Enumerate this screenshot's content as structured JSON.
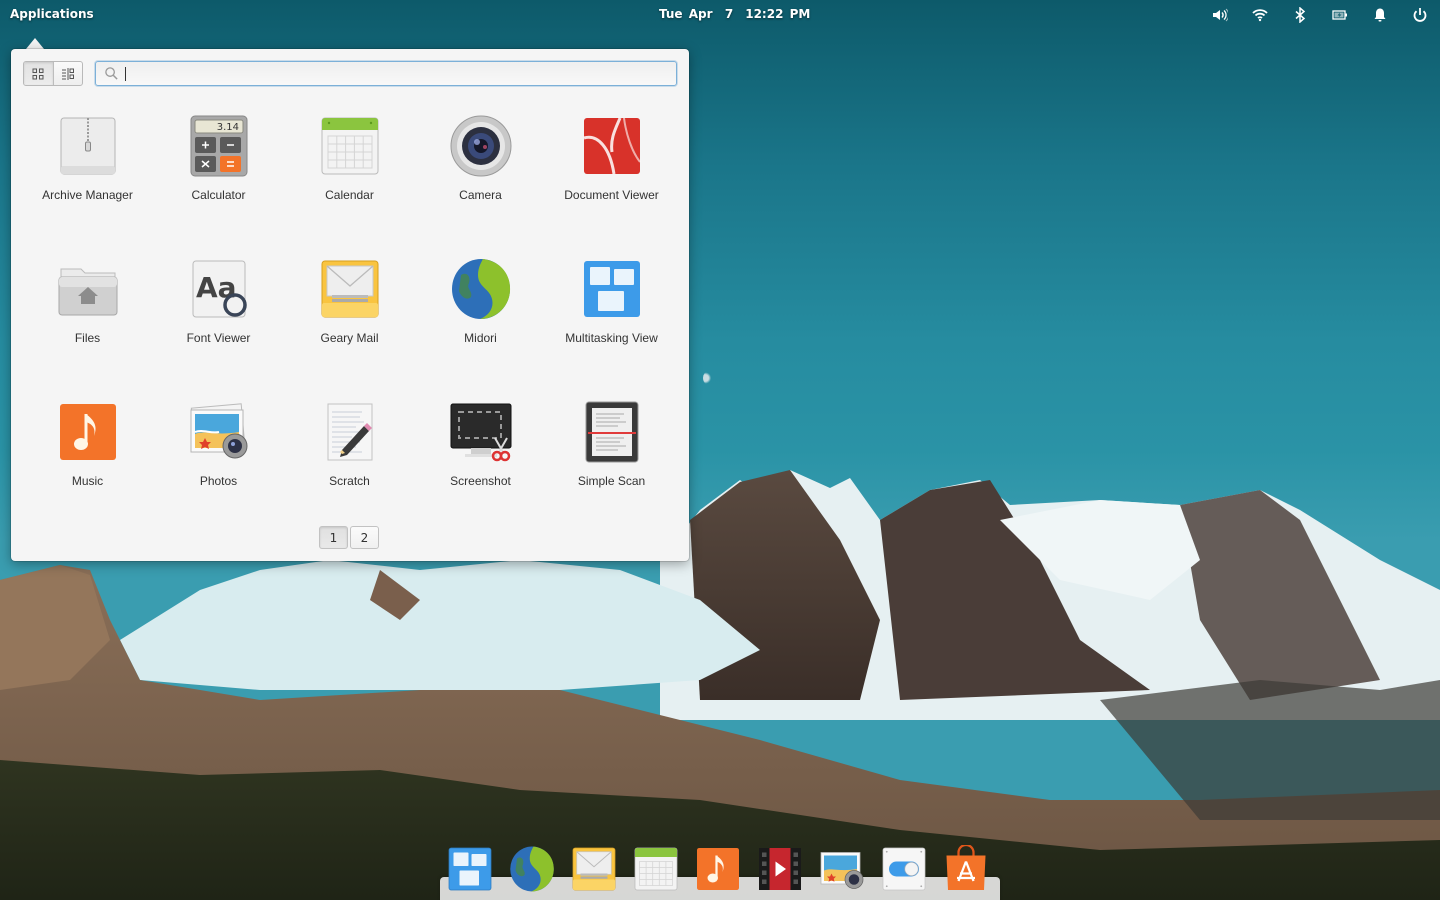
{
  "panel": {
    "applications_label": "Applications",
    "date": "Tue Apr  7",
    "time": "12:22 PM",
    "indicators": [
      {
        "name": "sound-indicator",
        "icon": "volume-high-icon"
      },
      {
        "name": "network-indicator",
        "icon": "wifi-icon"
      },
      {
        "name": "bluetooth-indicator",
        "icon": "bluetooth-icon"
      },
      {
        "name": "power-indicator",
        "icon": "battery-charging-icon"
      },
      {
        "name": "notifications-indicator",
        "icon": "bell-icon"
      },
      {
        "name": "session-indicator",
        "icon": "power-icon"
      }
    ]
  },
  "launcher": {
    "view_modes": [
      {
        "label": "Grid View",
        "icon": "grid-icon",
        "active": true
      },
      {
        "label": "Category View",
        "icon": "category-list-icon",
        "active": false
      }
    ],
    "search": {
      "value": "",
      "placeholder": ""
    },
    "apps": [
      {
        "label": "Archive Manager",
        "icon": "archive-icon"
      },
      {
        "label": "Calculator",
        "icon": "calculator-icon",
        "display": "3.14"
      },
      {
        "label": "Calendar",
        "icon": "calendar-icon"
      },
      {
        "label": "Camera",
        "icon": "camera-icon"
      },
      {
        "label": "Document Viewer",
        "icon": "document-viewer-icon"
      },
      {
        "label": "Files",
        "icon": "files-icon"
      },
      {
        "label": "Font Viewer",
        "icon": "font-viewer-icon",
        "glyph": "Aa"
      },
      {
        "label": "Geary Mail",
        "icon": "mail-icon"
      },
      {
        "label": "Midori",
        "icon": "midori-icon"
      },
      {
        "label": "Multitasking View",
        "icon": "multitasking-icon"
      },
      {
        "label": "Music",
        "icon": "music-icon"
      },
      {
        "label": "Photos",
        "icon": "photos-icon"
      },
      {
        "label": "Scratch",
        "icon": "scratch-icon"
      },
      {
        "label": "Screenshot",
        "icon": "screenshot-icon"
      },
      {
        "label": "Simple Scan",
        "icon": "simple-scan-icon"
      }
    ],
    "pages": [
      {
        "label": "1",
        "active": true
      },
      {
        "label": "2",
        "active": false
      }
    ]
  },
  "dock": {
    "items": [
      {
        "label": "Multitasking View",
        "icon": "multitasking-icon"
      },
      {
        "label": "Midori",
        "icon": "midori-icon"
      },
      {
        "label": "Geary Mail",
        "icon": "mail-icon"
      },
      {
        "label": "Calendar",
        "icon": "calendar-icon"
      },
      {
        "label": "Music",
        "icon": "music-icon"
      },
      {
        "label": "Videos",
        "icon": "videos-icon"
      },
      {
        "label": "Photos",
        "icon": "photos-icon"
      },
      {
        "label": "System Settings",
        "icon": "settings-toggle-icon"
      },
      {
        "label": "AppCenter",
        "icon": "appcenter-icon"
      }
    ]
  },
  "colors": {
    "accent_blue": "#3d9be9",
    "panel_text": "#ffffff",
    "launcher_bg": "#f5f5f5",
    "music_orange": "#f37329",
    "calendar_green": "#8bc53f"
  }
}
